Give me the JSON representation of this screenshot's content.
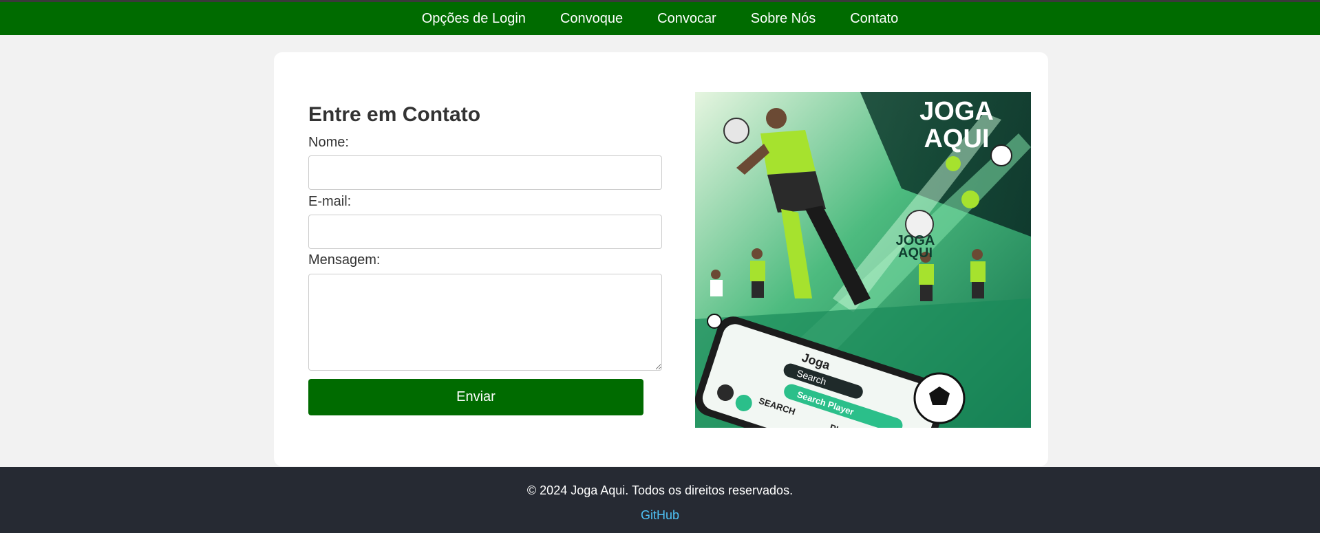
{
  "nav": {
    "items": [
      {
        "label": "Opções de Login"
      },
      {
        "label": "Convoque"
      },
      {
        "label": "Convocar"
      },
      {
        "label": "Sobre Nós"
      },
      {
        "label": "Contato"
      }
    ]
  },
  "contact_form": {
    "title": "Entre em Contato",
    "name_label": "Nome:",
    "name_value": "",
    "email_label": "E-mail:",
    "email_value": "",
    "message_label": "Mensagem:",
    "message_value": "",
    "submit_label": "Enviar"
  },
  "promo_image": {
    "brand_line1": "JOGA",
    "brand_line2": "AQUI",
    "small_brand_line1": "JOGA",
    "small_brand_line2": "AQUI",
    "phone_app_title": "Joga",
    "phone_search_label": "Search",
    "phone_search_pill": "Search Player",
    "phone_search_caption": "SEARCH",
    "phone_player_caption": "PLAYER"
  },
  "footer": {
    "copyright": "© 2024 Joga Aqui. Todos os direitos reservados.",
    "github_label": "GitHub"
  },
  "colors": {
    "nav_green": "#006b00",
    "footer_dark": "#262a33",
    "link_blue": "#4fc3f7",
    "jersey_lime": "#a6e22e"
  }
}
